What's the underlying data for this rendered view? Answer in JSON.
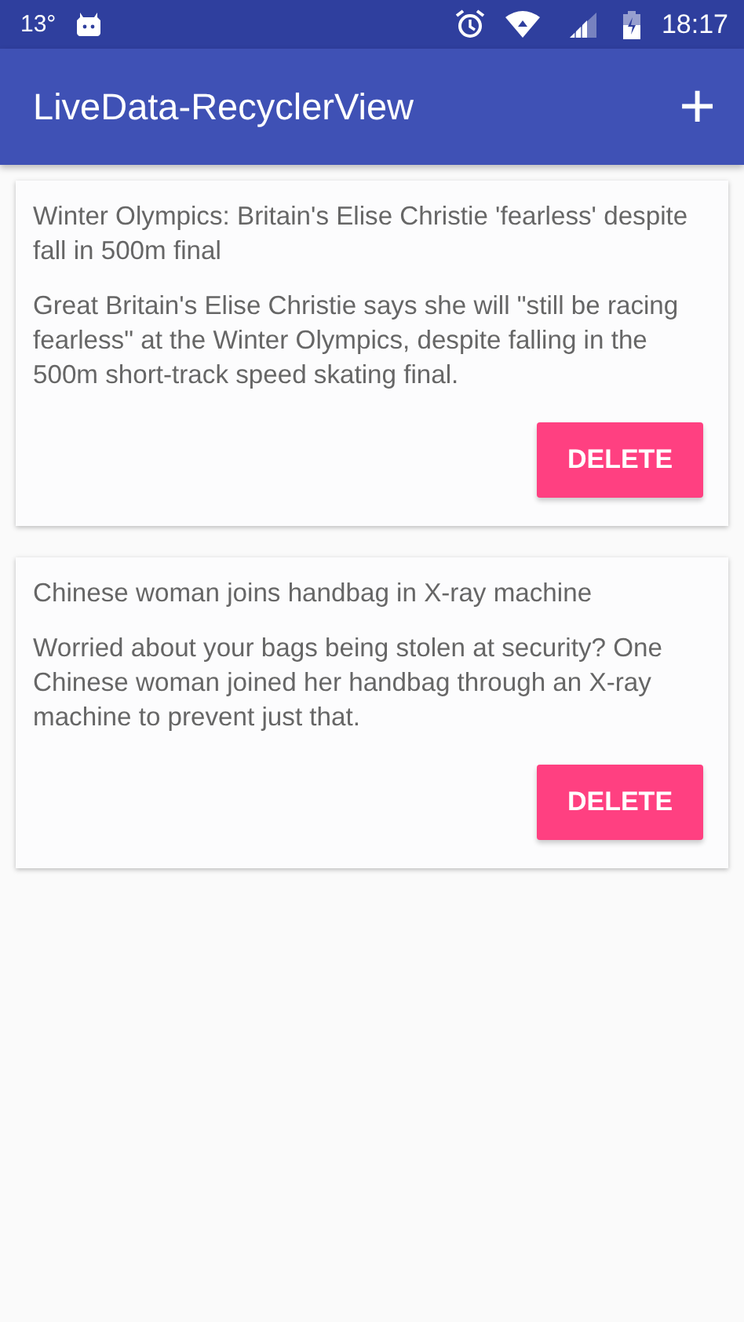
{
  "status_bar": {
    "temperature": "13°",
    "time": "18:17"
  },
  "app_bar": {
    "title": "LiveData-RecyclerView",
    "action": "+"
  },
  "cards": [
    {
      "title": "Winter Olympics: Britain's Elise Christie 'fearless' despite fall in 500m final",
      "body": "Great Britain's Elise Christie says she will \"still be racing fearless\" at the Winter Olympics, despite falling in the 500m short-track speed skating final.",
      "button": "DELETE"
    },
    {
      "title": "Chinese woman joins handbag in X-ray machine",
      "body": "Worried about your bags being stolen at security? One Chinese woman joined her handbag through an X-ray machine to prevent just that.",
      "button": "DELETE"
    }
  ]
}
